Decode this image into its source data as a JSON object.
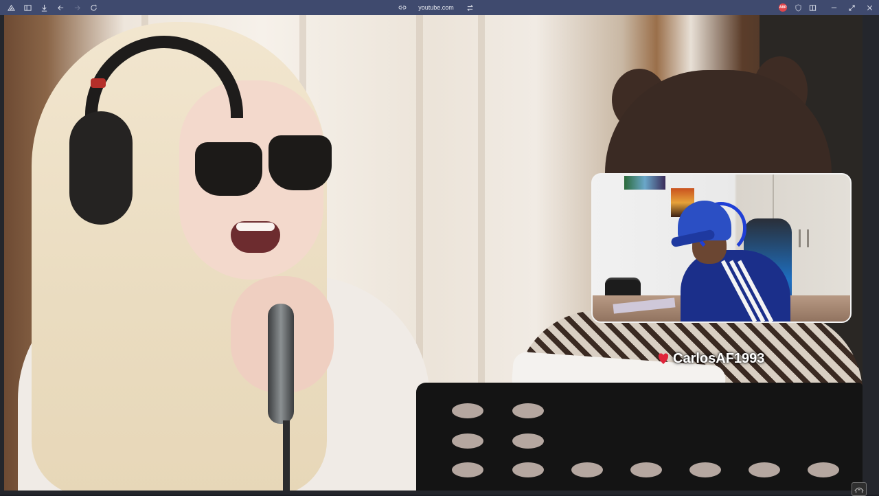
{
  "browser": {
    "url": "youtube.com",
    "toolbar_icons": [
      "workspaces-icon",
      "sidebar-icon",
      "download-icon",
      "back-icon",
      "forward-icon",
      "reload-icon"
    ],
    "address_icons": [
      "link-icon",
      "site-settings-icon"
    ],
    "right_icons": [
      "adblock-icon",
      "shield-icon",
      "panel-icon"
    ],
    "window_controls": [
      "minimize-icon",
      "restore-icon",
      "close-icon"
    ],
    "adblock_badge": "ABP"
  },
  "video": {
    "overlay_username": "CarlosAF1993",
    "webcam_overlay": true,
    "channel_watermark": "icon"
  },
  "colors": {
    "chrome": "#3f4a6e",
    "username_heart": "#e0243a"
  }
}
